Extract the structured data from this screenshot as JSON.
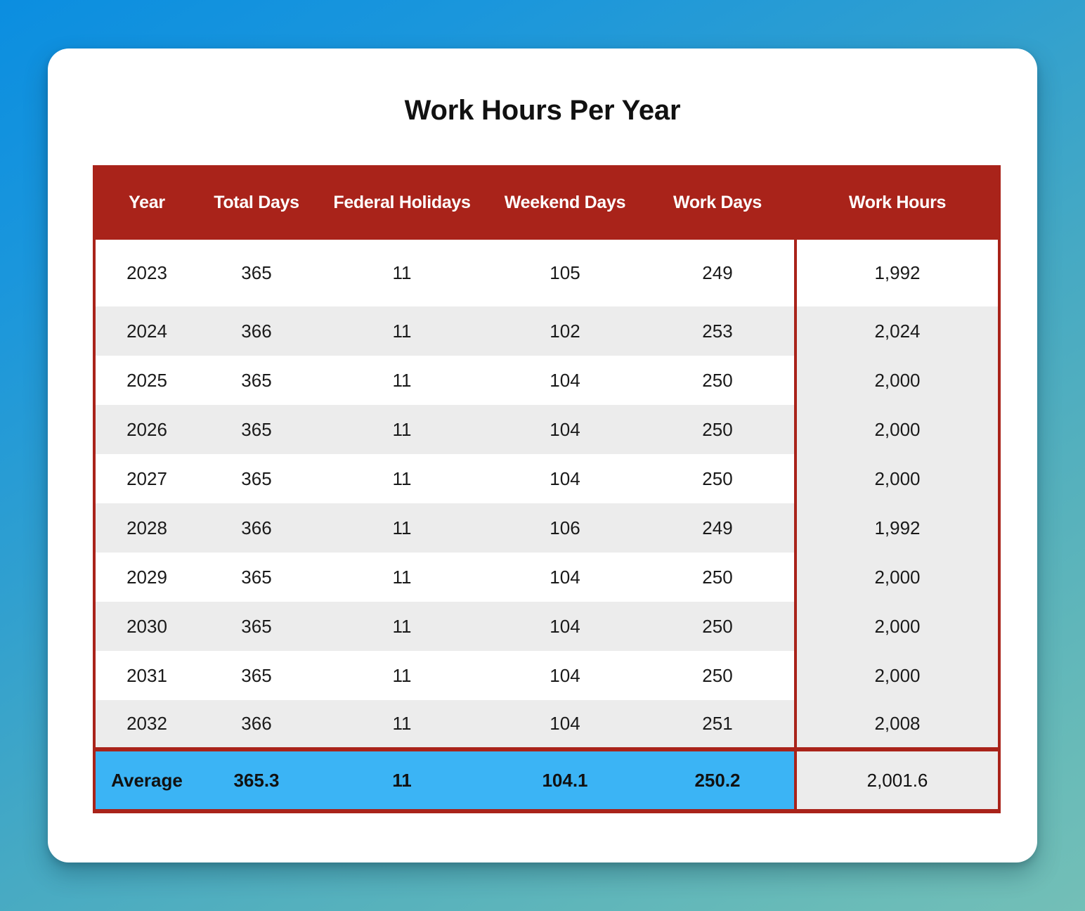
{
  "card": {
    "title": "Work Hours Per Year"
  },
  "theme": {
    "header_bg": "#A9231A",
    "border": "#A9231A",
    "row_alt_bg": "#ececec",
    "row_bg": "#ffffff",
    "average_bg": "#3BB4F5",
    "card_bg": "#ffffff",
    "page_gradient_start": "#0b8ee0",
    "page_gradient_end": "#73bfb7",
    "text": "#1a1a1a"
  },
  "table": {
    "columns": [
      "Year",
      "Total Days",
      "Federal Holidays",
      "Weekend Days",
      "Work Days",
      "Work Hours"
    ],
    "rows": [
      {
        "year": "2023",
        "total_days": "365",
        "federal_holidays": "11",
        "weekend_days": "105",
        "work_days": "249",
        "work_hours": "1,992"
      },
      {
        "year": "2024",
        "total_days": "366",
        "federal_holidays": "11",
        "weekend_days": "102",
        "work_days": "253",
        "work_hours": "2,024"
      },
      {
        "year": "2025",
        "total_days": "365",
        "federal_holidays": "11",
        "weekend_days": "104",
        "work_days": "250",
        "work_hours": "2,000"
      },
      {
        "year": "2026",
        "total_days": "365",
        "federal_holidays": "11",
        "weekend_days": "104",
        "work_days": "250",
        "work_hours": "2,000"
      },
      {
        "year": "2027",
        "total_days": "365",
        "federal_holidays": "11",
        "weekend_days": "104",
        "work_days": "250",
        "work_hours": "2,000"
      },
      {
        "year": "2028",
        "total_days": "366",
        "federal_holidays": "11",
        "weekend_days": "106",
        "work_days": "249",
        "work_hours": "1,992"
      },
      {
        "year": "2029",
        "total_days": "365",
        "federal_holidays": "11",
        "weekend_days": "104",
        "work_days": "250",
        "work_hours": "2,000"
      },
      {
        "year": "2030",
        "total_days": "365",
        "federal_holidays": "11",
        "weekend_days": "104",
        "work_days": "250",
        "work_hours": "2,000"
      },
      {
        "year": "2031",
        "total_days": "365",
        "federal_holidays": "11",
        "weekend_days": "104",
        "work_days": "250",
        "work_hours": "2,000"
      },
      {
        "year": "2032",
        "total_days": "366",
        "federal_holidays": "11",
        "weekend_days": "104",
        "work_days": "251",
        "work_hours": "2,008"
      }
    ],
    "summary": {
      "label": "Average",
      "total_days": "365.3",
      "federal_holidays": "11",
      "weekend_days": "104.1",
      "work_days": "250.2",
      "work_hours": "2,001.6"
    }
  },
  "chart_data": {
    "type": "table",
    "title": "Work Hours Per Year",
    "columns": [
      "Year",
      "Total Days",
      "Federal Holidays",
      "Weekend Days",
      "Work Days",
      "Work Hours"
    ],
    "rows": [
      [
        "2023",
        365,
        11,
        105,
        249,
        1992
      ],
      [
        "2024",
        366,
        11,
        102,
        253,
        2024
      ],
      [
        "2025",
        365,
        11,
        104,
        250,
        2000
      ],
      [
        "2026",
        365,
        11,
        104,
        250,
        2000
      ],
      [
        "2027",
        365,
        11,
        104,
        250,
        2000
      ],
      [
        "2028",
        366,
        11,
        106,
        249,
        1992
      ],
      [
        "2029",
        365,
        11,
        104,
        250,
        2000
      ],
      [
        "2030",
        365,
        11,
        104,
        250,
        2000
      ],
      [
        "2031",
        365,
        11,
        104,
        250,
        2000
      ],
      [
        "2032",
        366,
        11,
        104,
        251,
        2008
      ]
    ],
    "summary_row": [
      "Average",
      365.3,
      11,
      104.1,
      250.2,
      2001.6
    ]
  }
}
